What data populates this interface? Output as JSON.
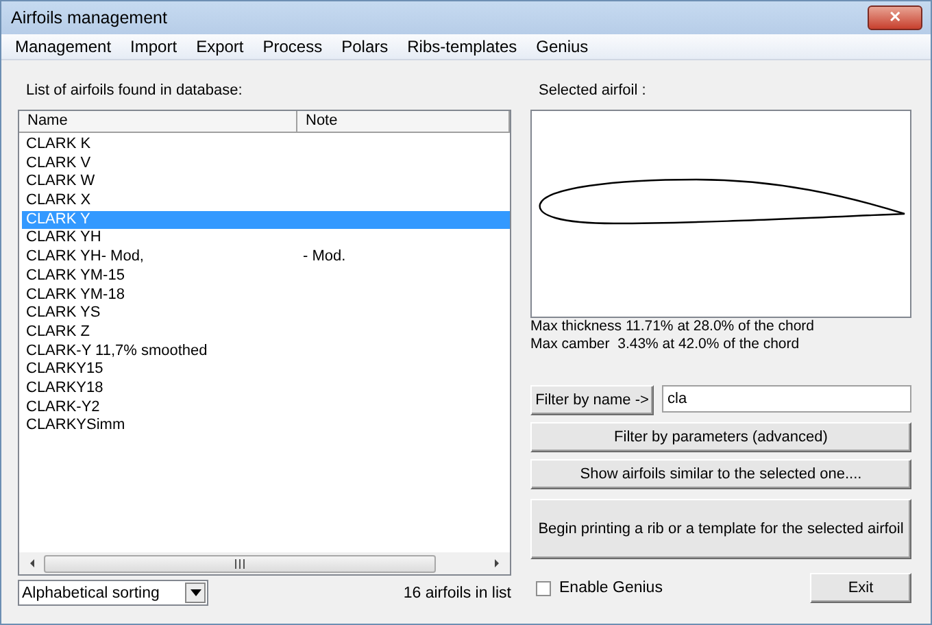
{
  "window": {
    "title": "Airfoils management",
    "close": "✕"
  },
  "menu": [
    "Management",
    "Import",
    "Export",
    "Process",
    "Polars",
    "Ribs-templates",
    "Genius"
  ],
  "list": {
    "label": "List of airfoils found in database:",
    "columns": [
      "Name",
      "Note"
    ],
    "rows": [
      {
        "name": "CLARK K",
        "note": "",
        "selected": false
      },
      {
        "name": "CLARK V",
        "note": "",
        "selected": false
      },
      {
        "name": "CLARK W",
        "note": "",
        "selected": false
      },
      {
        "name": "CLARK X",
        "note": "",
        "selected": false
      },
      {
        "name": "CLARK Y",
        "note": "",
        "selected": true
      },
      {
        "name": "CLARK YH",
        "note": "",
        "selected": false
      },
      {
        "name": "CLARK YH- Mod,",
        "note": "- Mod.",
        "selected": false
      },
      {
        "name": "CLARK YM-15",
        "note": "",
        "selected": false
      },
      {
        "name": "CLARK YM-18",
        "note": "",
        "selected": false
      },
      {
        "name": "CLARK YS",
        "note": "",
        "selected": false
      },
      {
        "name": "CLARK Z",
        "note": "",
        "selected": false
      },
      {
        "name": "CLARK-Y 11,7% smoothed",
        "note": "",
        "selected": false
      },
      {
        "name": "CLARKY15",
        "note": "",
        "selected": false
      },
      {
        "name": "CLARKY18",
        "note": "",
        "selected": false
      },
      {
        "name": "CLARK-Y2",
        "note": "",
        "selected": false
      },
      {
        "name": "CLARKYSimm",
        "note": "",
        "selected": false
      }
    ]
  },
  "sorting": {
    "value": "Alphabetical sorting"
  },
  "count": "16 airfoils in list",
  "preview": {
    "label": "Selected airfoil :",
    "thickness": "Max thickness 11.71% at 28.0% of the chord",
    "camber": "Max camber  3.43% at 42.0% of the chord"
  },
  "filter": {
    "button": "Filter by name ->",
    "value": "cla"
  },
  "buttons": [
    "Filter by parameters (advanced)",
    "Show airfoils similar to the selected one....",
    "Begin printing a rib or a template for the selected airfoil"
  ],
  "genius": {
    "label": "Enable Genius",
    "checked": false
  },
  "exit": "Exit"
}
